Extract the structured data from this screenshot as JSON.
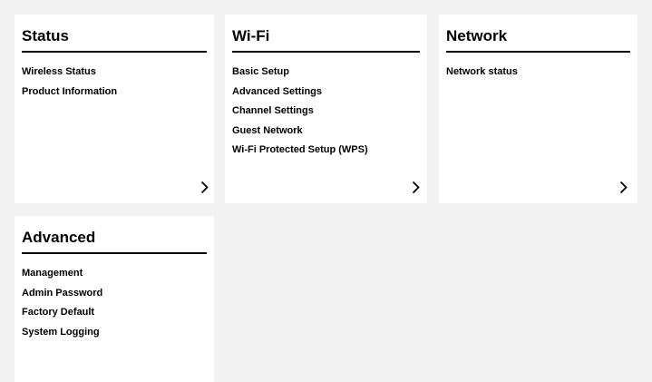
{
  "cards": {
    "status": {
      "title": "Status",
      "links": [
        "Wireless Status",
        "Product Information"
      ]
    },
    "wifi": {
      "title": "Wi-Fi",
      "links": [
        "Basic Setup",
        "Advanced Settings",
        "Channel Settings",
        "Guest Network",
        "Wi-Fi Protected Setup (WPS)"
      ]
    },
    "network": {
      "title": "Network",
      "links": [
        "Network status"
      ]
    },
    "advanced": {
      "title": "Advanced",
      "links": [
        "Management",
        "Admin Password",
        "Factory Default",
        "System Logging"
      ]
    }
  },
  "icons": {
    "more": "chevron-right-icon"
  },
  "colors": {
    "page_background": "#f2f2f2",
    "card_background": "#ffffff",
    "text": "#000000"
  }
}
